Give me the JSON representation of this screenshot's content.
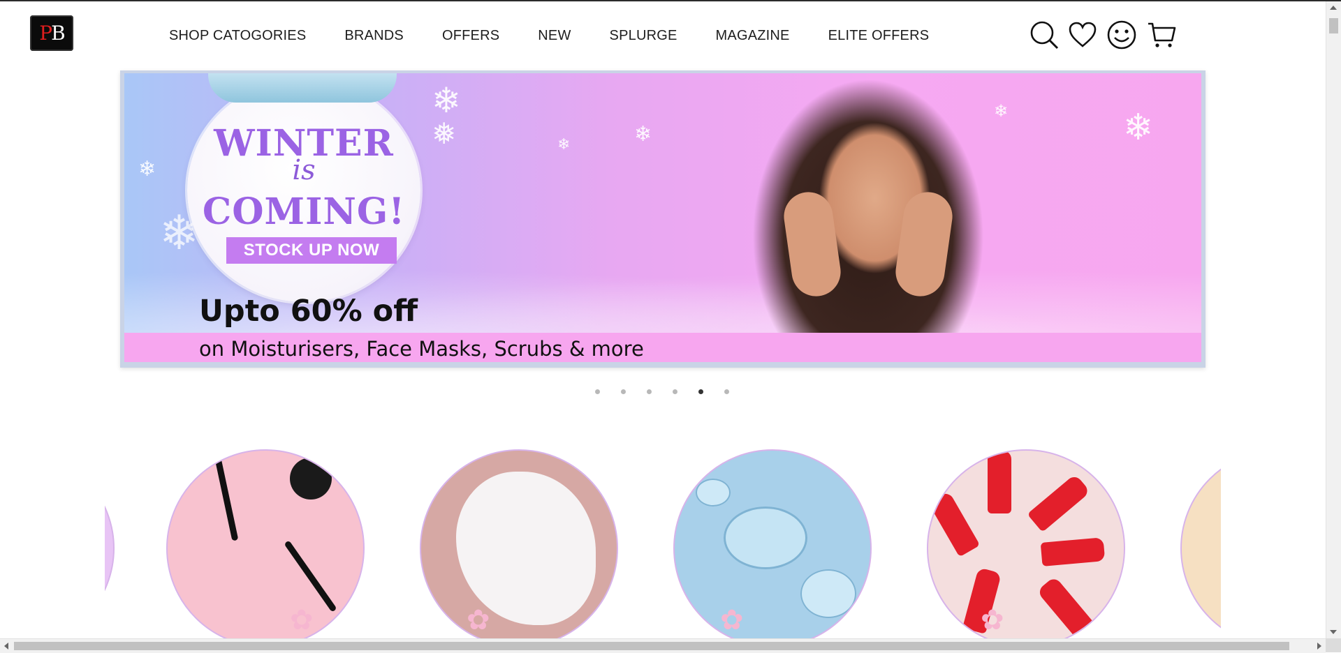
{
  "header": {
    "logo_text_p": "P",
    "logo_text_b": "B",
    "nav": [
      {
        "label": "SHOP CATOGORIES"
      },
      {
        "label": "BRANDS"
      },
      {
        "label": "OFFERS"
      },
      {
        "label": "NEW"
      },
      {
        "label": "SPLURGE"
      },
      {
        "label": "MAGAZINE"
      },
      {
        "label": "ELITE OFFERS"
      }
    ],
    "icons": [
      "search-icon",
      "heart-icon",
      "smiley-account-icon",
      "cart-icon"
    ]
  },
  "banner": {
    "badge_line1": "WINTER",
    "badge_line2": "is",
    "badge_line3": "COMING!",
    "badge_cta": "STOCK UP NOW",
    "promo_headline": "Upto 60% off",
    "promo_sub": "on Moisturisers, Face Masks, Scrubs & more"
  },
  "carousel": {
    "total_slides": 6,
    "active_slide": 5
  },
  "categories": [
    {
      "image": "purple-product"
    },
    {
      "image": "eyeliner"
    },
    {
      "image": "cream"
    },
    {
      "image": "gel-drops"
    },
    {
      "image": "lipsticks"
    },
    {
      "image": "foundation"
    }
  ],
  "colors": {
    "banner_lilac": "#c6b1f7",
    "banner_pink": "#f7a7ef",
    "badge_purple": "#9b63e4",
    "cta_purple": "#c47cf0",
    "logo_red": "#e01e1e"
  }
}
